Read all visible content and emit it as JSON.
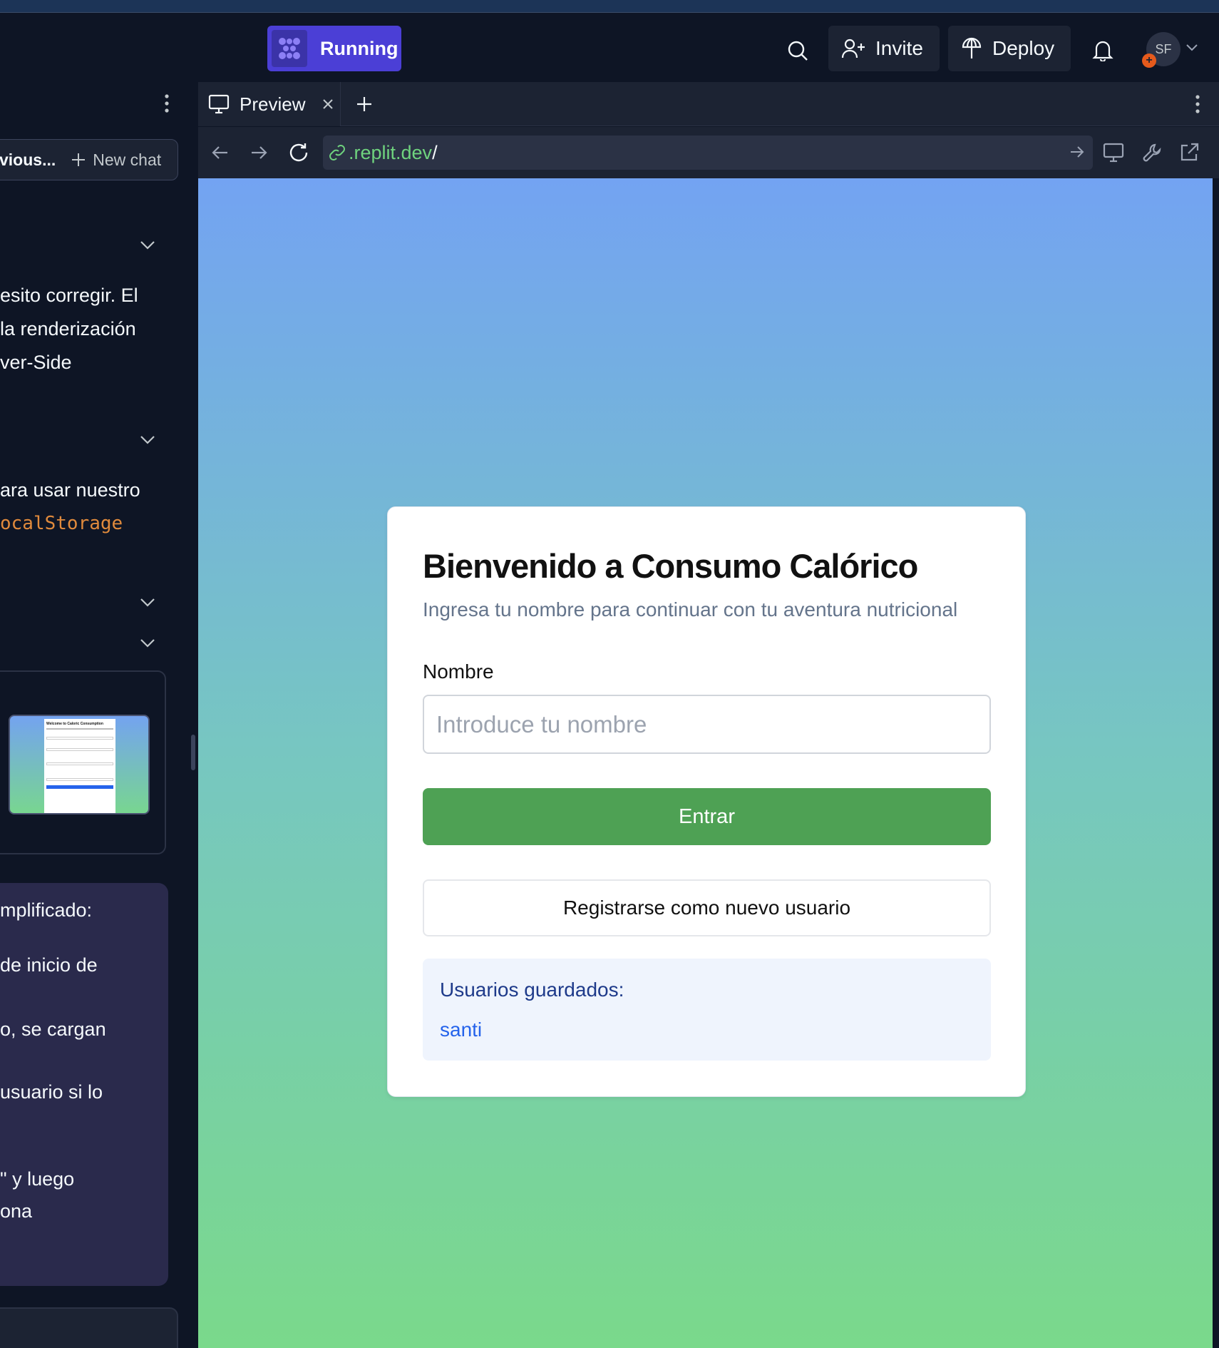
{
  "topbar": {
    "status_label": "Running",
    "invite_label": "Invite",
    "deploy_label": "Deploy",
    "avatar_initials": "SF",
    "avatar_badge": "+"
  },
  "left_panel": {
    "previous_label": "vious...",
    "new_chat_label": "New chat",
    "message_lines": [
      "esito corregir. El",
      "la renderización",
      "ver-Side",
      "ara usar nuestro"
    ],
    "code_snippet": "ocalStorage",
    "thumb_title": "Welcome to Caloric Consumption",
    "purple_lines": [
      "mplificado:",
      "de inicio de",
      "o, se cargan",
      "usuario si lo",
      "\" y luego",
      "ona"
    ]
  },
  "preview_tab": {
    "tab_label": "Preview",
    "url_host": ".replit.dev",
    "url_path": "/"
  },
  "app": {
    "title": "Bienvenido a Consumo Calórico",
    "subtitle": "Ingresa tu nombre para continuar con tu aventura nutricional",
    "name_label": "Nombre",
    "name_placeholder": "Introduce tu nombre",
    "enter_button": "Entrar",
    "register_button": "Registrarse como nuevo usuario",
    "saved_users_title": "Usuarios guardados:",
    "saved_users": [
      "santi"
    ]
  },
  "colors": {
    "running_accent": "#4b3fd6",
    "enter_button": "#4ea154",
    "url_host": "#6fd37e",
    "saved_users_link": "#2563eb"
  }
}
